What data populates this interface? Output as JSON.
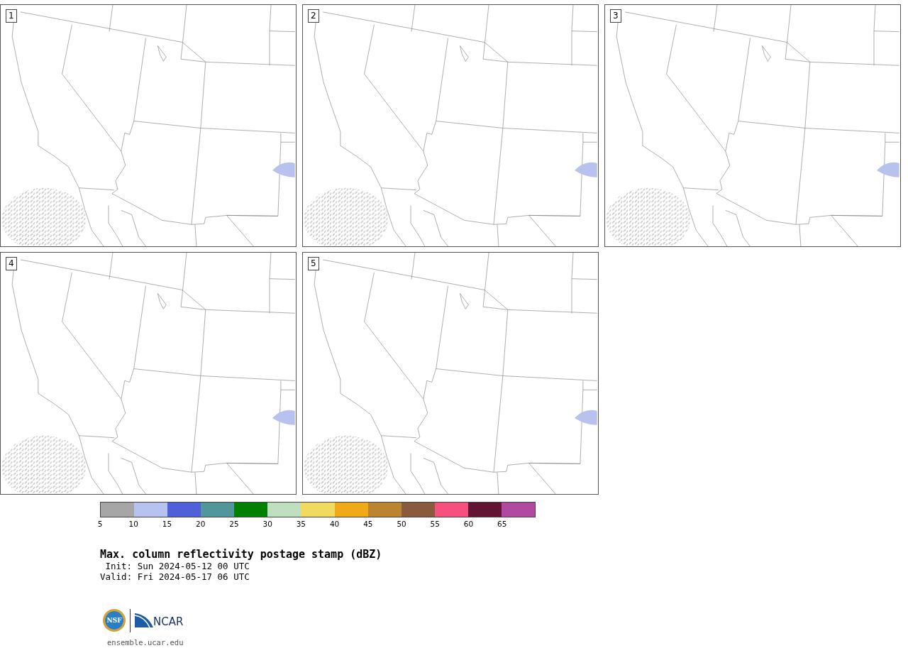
{
  "panels": [
    {
      "label": "1"
    },
    {
      "label": "2"
    },
    {
      "label": "3"
    },
    {
      "label": "4"
    },
    {
      "label": "5"
    }
  ],
  "colorbar": {
    "segments": [
      {
        "color": "#a6a6a6"
      },
      {
        "color": "#b8c2ee"
      },
      {
        "color": "#5060d8"
      },
      {
        "color": "#50969a"
      },
      {
        "color": "#008000"
      },
      {
        "color": "#c0dec0"
      },
      {
        "color": "#f0da60"
      },
      {
        "color": "#f0aa18"
      },
      {
        "color": "#bb8430"
      },
      {
        "color": "#8a5a3e"
      },
      {
        "color": "#f5507e"
      },
      {
        "color": "#621434"
      },
      {
        "color": "#b04aa0"
      }
    ],
    "ticks": [
      "5",
      "10",
      "15",
      "20",
      "25",
      "30",
      "35",
      "40",
      "45",
      "50",
      "55",
      "60",
      "65"
    ]
  },
  "title": "Max. column reflectivity postage stamp (dBZ)",
  "init": "Init: Sun 2024-05-12 00 UTC",
  "valid": "Valid: Fri 2024-05-17 06 UTC",
  "logos": {
    "nsf": "NSF",
    "ncar": "NCAR"
  },
  "url": "ensemble.ucar.edu"
}
